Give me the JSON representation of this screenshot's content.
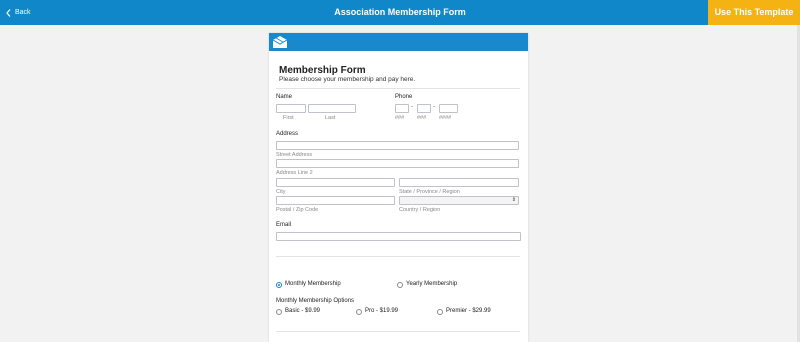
{
  "topbar": {
    "back_label": "Back",
    "title": "Association Membership Form",
    "use_template_label": "Use This Template"
  },
  "colors": {
    "topbar": "#0f87c9",
    "accent_button": "#f5b213",
    "form_header": "#1a88cc",
    "radio_selected": "#1a7fd0"
  },
  "icons": {
    "back": "chevron-left-icon",
    "logo": "envelope-logo-icon",
    "select": "up-down-arrow-icon"
  },
  "form": {
    "title": "Membership Form",
    "subtitle": "Please choose your membership and pay here.",
    "name": {
      "label": "Name",
      "first": "First",
      "last": "Last",
      "first_value": "",
      "last_value": ""
    },
    "phone": {
      "label": "Phone",
      "sub1": "###",
      "sub2": "###",
      "sub3": "####",
      "sep": "-"
    },
    "address": {
      "label": "Address",
      "street": "Street Address",
      "line2": "Address Line 2",
      "city": "City",
      "state": "State / Province / Region",
      "postal": "Postal / Zip Code",
      "country": "Country / Region",
      "country_value": ""
    },
    "email": {
      "label": "Email",
      "value": ""
    },
    "membership": {
      "monthly": "Monthly Membership",
      "yearly": "Yearly Membership",
      "selected": "Monthly Membership"
    },
    "options": {
      "label": "Monthly Membership Options",
      "basic": "Basic - $9.99",
      "pro": "Pro - $19.99",
      "premier": "Premier - $29.99"
    }
  }
}
